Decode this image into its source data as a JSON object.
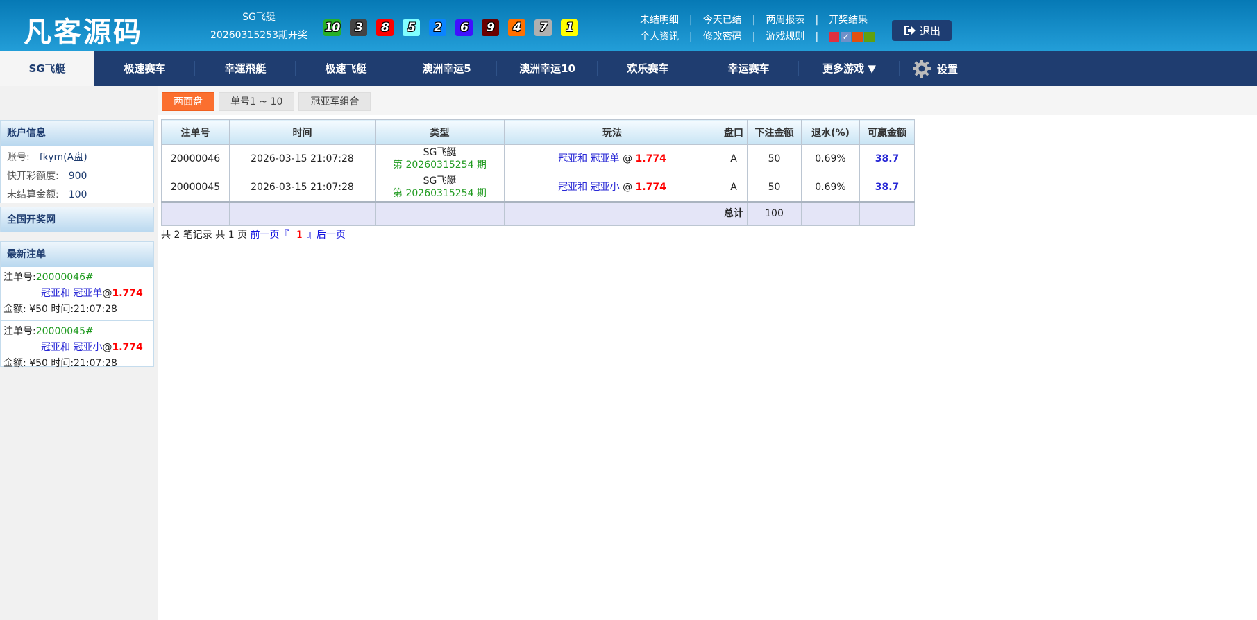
{
  "header": {
    "logo": "凡客源码",
    "game": "SG飞艇",
    "period_text": "20260315253期开奖",
    "balls": [
      {
        "n": "10",
        "c": "#27b027"
      },
      {
        "n": "3",
        "c": "#444444"
      },
      {
        "n": "8",
        "c": "#ff0000"
      },
      {
        "n": "5",
        "c": "#80ffff"
      },
      {
        "n": "2",
        "c": "#0a84ff"
      },
      {
        "n": "6",
        "c": "#4010ff"
      },
      {
        "n": "9",
        "c": "#6a0000"
      },
      {
        "n": "4",
        "c": "#ff7000"
      },
      {
        "n": "7",
        "c": "#b0b0b0"
      },
      {
        "n": "1",
        "c": "#ffff00"
      }
    ],
    "links_row1": [
      "未结明细",
      "今天已结",
      "两周报表",
      "开奖结果"
    ],
    "links_row2": [
      "个人资讯",
      "修改密码",
      "游戏规则"
    ],
    "theme_colors": [
      "#e03040",
      "#7090c8",
      "#e05010",
      "#60a010"
    ],
    "logout": "退出"
  },
  "nav": {
    "items": [
      "SG飞艇",
      "极速赛车",
      "幸運飛艇",
      "极速飞艇",
      "澳洲幸运5",
      "澳洲幸运10",
      "欢乐赛车",
      "幸运赛车",
      "更多游戏 ▼"
    ],
    "settings": "设置"
  },
  "subtabs": [
    "两面盘",
    "单号1 ~ 10",
    "冠亚军组合"
  ],
  "sidebar": {
    "account_title": "账户信息",
    "account": [
      {
        "label": "账号:",
        "value": "fkym(A盘)"
      },
      {
        "label": "快开彩额度:",
        "value": "900"
      },
      {
        "label": "未结算金额:",
        "value": "100"
      }
    ],
    "lottery_site": "全国开奖网",
    "latest_title": "最新注单",
    "latest": [
      {
        "label": "注单号:",
        "id": "20000046#",
        "play": "冠亚和 冠亚单",
        "at": "@",
        "odds": "1.774",
        "amount": "金额: ¥50  时间:21:07:28"
      },
      {
        "label": "注单号:",
        "id": "20000045#",
        "play": "冠亚和 冠亚小",
        "at": "@",
        "odds": "1.774",
        "amount": "金额: ¥50  时间:21:07:28"
      }
    ]
  },
  "table": {
    "headers": [
      "注单号",
      "时间",
      "类型",
      "玩法",
      "盘口",
      "下注金额",
      "退水(%)",
      "可赢金额"
    ],
    "rows": [
      {
        "id": "20000046",
        "time": "2026-03-15 21:07:28",
        "game": "SG飞艇",
        "period": "第 20260315254 期",
        "play": "冠亚和 冠亚单",
        "at": "@",
        "odds": "1.774",
        "pan": "A",
        "amount": "50",
        "rebate": "0.69%",
        "win": "38.7"
      },
      {
        "id": "20000045",
        "time": "2026-03-15 21:07:28",
        "game": "SG飞艇",
        "period": "第 20260315254 期",
        "play": "冠亚和 冠亚小",
        "at": "@",
        "odds": "1.774",
        "pan": "A",
        "amount": "50",
        "rebate": "0.69%",
        "win": "38.7"
      }
    ],
    "total_label": "总计",
    "total_amount": "100"
  },
  "pager": {
    "summary": "共 2 笔记录 共 1 页",
    "prev": "前一页",
    "open": "『",
    "page": "1",
    "close": "』",
    "next": "后一页"
  }
}
